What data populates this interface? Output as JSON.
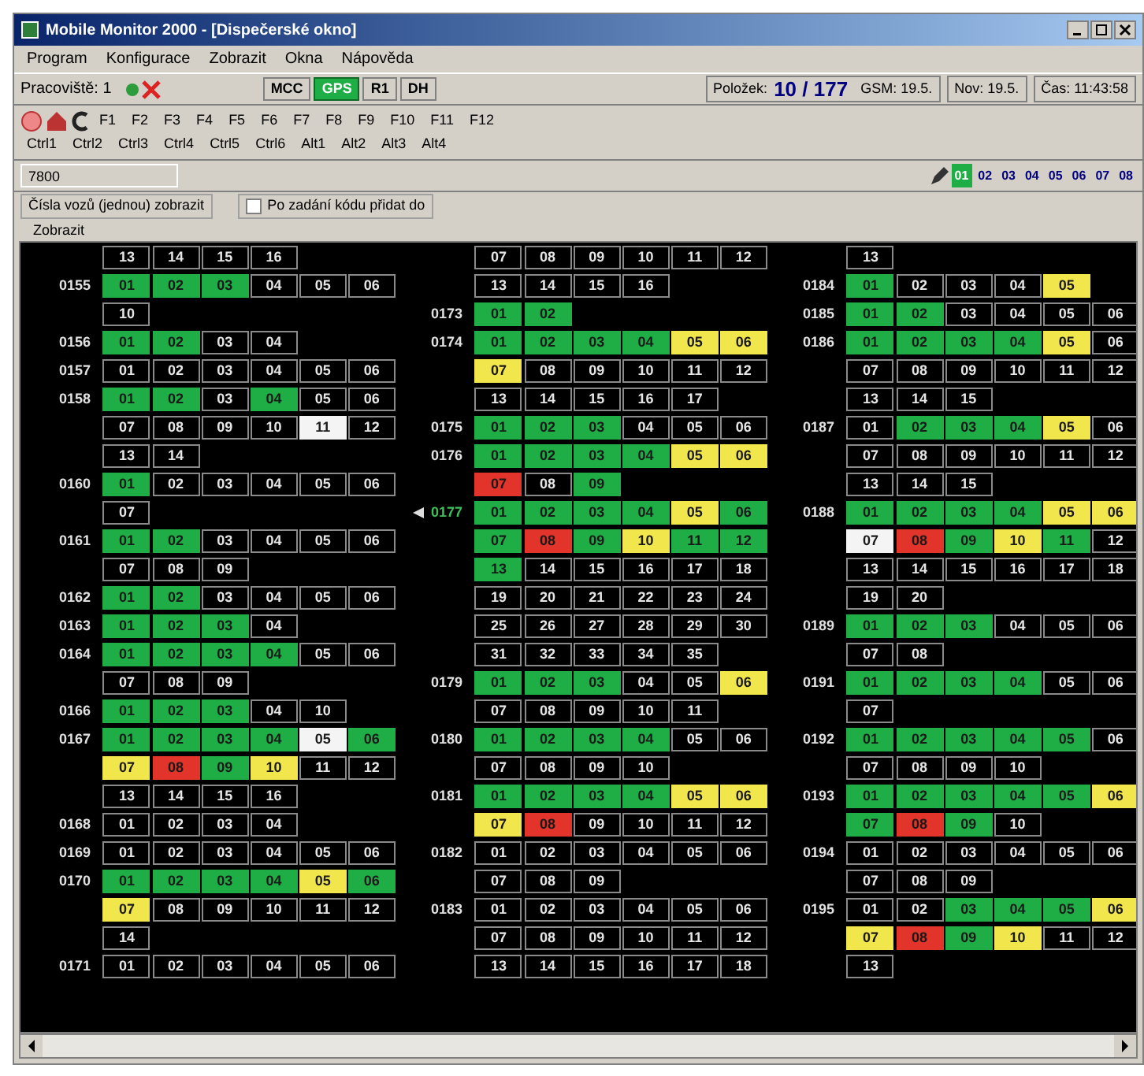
{
  "window": {
    "title": "Mobile Monitor 2000 - [Dispečerské okno]"
  },
  "menu": [
    "Program",
    "Konfigurace",
    "Zobrazit",
    "Okna",
    "Nápověda"
  ],
  "toolbar": {
    "workstation": "Pracoviště: 1",
    "modes": [
      {
        "label": "MCC",
        "selected": false
      },
      {
        "label": "GPS",
        "selected": true
      },
      {
        "label": "R1",
        "selected": false
      },
      {
        "label": "DH",
        "selected": false
      }
    ],
    "count_label": "Položek:",
    "count": "10 / 177",
    "gsm": "GSM: 19.5.",
    "nov": "Nov: 19.5.",
    "time": "Čas: 11:43:58"
  },
  "keys_row_1": [
    "F1",
    "F2",
    "F3",
    "F4",
    "F5",
    "F6",
    "F7",
    "F8",
    "F9",
    "F10",
    "F11",
    "F12"
  ],
  "keys_row_2": [
    "Ctrl1",
    "Ctrl2",
    "Ctrl3",
    "Ctrl4",
    "Ctrl5",
    "Ctrl6",
    "Alt1",
    "Alt2",
    "Alt3",
    "Alt4"
  ],
  "code_field": {
    "value": "7800"
  },
  "lines": [
    {
      "label": "01",
      "selected": true
    },
    {
      "label": "02",
      "selected": false
    },
    {
      "label": "03",
      "selected": false
    },
    {
      "label": "04",
      "selected": false
    },
    {
      "label": "05",
      "selected": false
    },
    {
      "label": "06",
      "selected": false
    },
    {
      "label": "07",
      "selected": false
    },
    {
      "label": "08",
      "selected": false
    }
  ],
  "filter": {
    "label": "Čísla vozů (jednou) zobrazit",
    "checkbox": {
      "label": "Po zadání kódu přidat do",
      "checked": false
    },
    "sub_label": "Zobrazit"
  },
  "columns": [
    {
      "groups": [
        {
          "cells": [
            {
              "text": "13"
            },
            {
              "text": "14"
            },
            {
              "text": "15"
            },
            {
              "text": "16"
            }
          ]
        },
        {
          "label": "0155",
          "current": false,
          "cells": [
            {
              "text": "01",
              "color": "#1fae45"
            },
            {
              "text": "02",
              "color": "#1fae45"
            },
            {
              "text": "03",
              "color": "#1fae45"
            },
            {
              "text": "04"
            },
            {
              "text": "05"
            },
            {
              "text": "06"
            },
            {
              "text": "10"
            }
          ]
        },
        {
          "label": "0156",
          "current": false,
          "cells": [
            {
              "text": "01",
              "color": "#1fae45"
            },
            {
              "text": "02",
              "color": "#1fae45"
            },
            {
              "text": "03"
            },
            {
              "text": "04"
            }
          ]
        },
        {
          "label": "0157",
          "current": false,
          "cells": [
            {
              "text": "01"
            },
            {
              "text": "02"
            },
            {
              "text": "03"
            },
            {
              "text": "04"
            },
            {
              "text": "05"
            },
            {
              "text": "06"
            }
          ]
        },
        {
          "label": "0158",
          "current": false,
          "cells": [
            {
              "text": "01",
              "color": "#1fae45"
            },
            {
              "text": "02",
              "color": "#1fae45"
            },
            {
              "text": "03"
            },
            {
              "text": "04",
              "color": "#1fae45"
            },
            {
              "text": "05"
            },
            {
              "text": "06"
            },
            {
              "text": "07"
            },
            {
              "text": "08"
            },
            {
              "text": "09"
            },
            {
              "text": "10"
            },
            {
              "text": "11",
              "color": "#f4f4f4"
            },
            {
              "text": "12"
            },
            {
              "text": "13"
            },
            {
              "text": "14"
            }
          ]
        },
        {
          "label": "0160",
          "current": false,
          "cells": [
            {
              "text": "01",
              "color": "#1fae45"
            },
            {
              "text": "02"
            },
            {
              "text": "03"
            },
            {
              "text": "04"
            },
            {
              "text": "05"
            },
            {
              "text": "06"
            },
            {
              "text": "07"
            }
          ]
        },
        {
          "label": "0161",
          "current": false,
          "cells": [
            {
              "text": "01",
              "color": "#1fae45"
            },
            {
              "text": "02",
              "color": "#1fae45"
            },
            {
              "text": "03"
            },
            {
              "text": "04"
            },
            {
              "text": "05"
            },
            {
              "text": "06"
            },
            {
              "text": "07"
            },
            {
              "text": "08"
            },
            {
              "text": "09"
            }
          ]
        },
        {
          "label": "0162",
          "current": false,
          "cells": [
            {
              "text": "01",
              "color": "#1fae45"
            },
            {
              "text": "02",
              "color": "#1fae45"
            },
            {
              "text": "03"
            },
            {
              "text": "04"
            },
            {
              "text": "05"
            },
            {
              "text": "06"
            }
          ]
        },
        {
          "label": "0163",
          "current": false,
          "cells": [
            {
              "text": "01",
              "color": "#1fae45"
            },
            {
              "text": "02",
              "color": "#1fae45"
            },
            {
              "text": "03",
              "color": "#1fae45"
            },
            {
              "text": "04"
            }
          ]
        },
        {
          "label": "0164",
          "current": false,
          "cells": [
            {
              "text": "01",
              "color": "#1fae45"
            },
            {
              "text": "02",
              "color": "#1fae45"
            },
            {
              "text": "03",
              "color": "#1fae45"
            },
            {
              "text": "04",
              "color": "#1fae45"
            },
            {
              "text": "05"
            },
            {
              "text": "06"
            },
            {
              "text": "07"
            },
            {
              "text": "08"
            },
            {
              "text": "09"
            }
          ]
        },
        {
          "label": "0166",
          "current": false,
          "cells": [
            {
              "text": "01",
              "color": "#1fae45"
            },
            {
              "text": "02",
              "color": "#1fae45"
            },
            {
              "text": "03",
              "color": "#1fae45"
            },
            {
              "text": "04"
            },
            {
              "text": "10"
            }
          ]
        },
        {
          "label": "0167",
          "current": false,
          "cells": [
            {
              "text": "01",
              "color": "#1fae45"
            },
            {
              "text": "02",
              "color": "#1fae45"
            },
            {
              "text": "03",
              "color": "#1fae45"
            },
            {
              "text": "04",
              "color": "#1fae45"
            },
            {
              "text": "05",
              "color": "#f4f4f4"
            },
            {
              "text": "06",
              "color": "#1fae45"
            },
            {
              "text": "07",
              "color": "#f1e64c"
            },
            {
              "text": "08",
              "color": "#e2342b"
            },
            {
              "text": "09",
              "color": "#1fae45"
            },
            {
              "text": "10",
              "color": "#f1e64c"
            },
            {
              "text": "11"
            },
            {
              "text": "12"
            },
            {
              "text": "13"
            },
            {
              "text": "14"
            },
            {
              "text": "15"
            },
            {
              "text": "16"
            }
          ]
        },
        {
          "label": "0168",
          "current": false,
          "cells": [
            {
              "text": "01"
            },
            {
              "text": "02"
            },
            {
              "text": "03"
            },
            {
              "text": "04"
            }
          ]
        },
        {
          "label": "0169",
          "current": false,
          "cells": [
            {
              "text": "01"
            },
            {
              "text": "02"
            },
            {
              "text": "03"
            },
            {
              "text": "04"
            },
            {
              "text": "05"
            },
            {
              "text": "06"
            }
          ]
        },
        {
          "label": "0170",
          "current": false,
          "cells": [
            {
              "text": "01",
              "color": "#1fae45"
            },
            {
              "text": "02",
              "color": "#1fae45"
            },
            {
              "text": "03",
              "color": "#1fae45"
            },
            {
              "text": "04",
              "color": "#1fae45"
            },
            {
              "text": "05",
              "color": "#f1e64c"
            },
            {
              "text": "06",
              "color": "#1fae45"
            },
            {
              "text": "07",
              "color": "#f1e64c"
            },
            {
              "text": "08"
            },
            {
              "text": "09"
            },
            {
              "text": "10"
            },
            {
              "text": "11"
            },
            {
              "text": "12"
            },
            {
              "text": "14"
            }
          ]
        },
        {
          "label": "0171",
          "current": false,
          "cells": [
            {
              "text": "01"
            },
            {
              "text": "02"
            },
            {
              "text": "03"
            },
            {
              "text": "04"
            },
            {
              "text": "05"
            },
            {
              "text": "06"
            }
          ]
        }
      ]
    },
    {
      "groups": [
        {
          "cells": [
            {
              "text": "07"
            },
            {
              "text": "08"
            },
            {
              "text": "09"
            },
            {
              "text": "10"
            },
            {
              "text": "11"
            },
            {
              "text": "12"
            },
            {
              "text": "13"
            },
            {
              "text": "14"
            },
            {
              "text": "15"
            },
            {
              "text": "16"
            }
          ]
        },
        {
          "label": "0173",
          "current": false,
          "cells": [
            {
              "text": "01",
              "color": "#1fae45"
            },
            {
              "text": "02",
              "color": "#1fae45"
            }
          ]
        },
        {
          "label": "0174",
          "current": false,
          "cells": [
            {
              "text": "01",
              "color": "#1fae45"
            },
            {
              "text": "02",
              "color": "#1fae45"
            },
            {
              "text": "03",
              "color": "#1fae45"
            },
            {
              "text": "04",
              "color": "#1fae45"
            },
            {
              "text": "05",
              "color": "#f1e64c"
            },
            {
              "text": "06",
              "color": "#f1e64c"
            },
            {
              "text": "07",
              "color": "#f1e64c"
            },
            {
              "text": "08"
            },
            {
              "text": "09"
            },
            {
              "text": "10"
            },
            {
              "text": "11"
            },
            {
              "text": "12"
            },
            {
              "text": "13"
            },
            {
              "text": "14"
            },
            {
              "text": "15"
            },
            {
              "text": "16"
            },
            {
              "text": "17"
            }
          ]
        },
        {
          "label": "0175",
          "current": false,
          "cells": [
            {
              "text": "01",
              "color": "#1fae45"
            },
            {
              "text": "02",
              "color": "#1fae45"
            },
            {
              "text": "03",
              "color": "#1fae45"
            },
            {
              "text": "04"
            },
            {
              "text": "05"
            },
            {
              "text": "06"
            }
          ]
        },
        {
          "label": "0176",
          "current": false,
          "cells": [
            {
              "text": "01",
              "color": "#1fae45"
            },
            {
              "text": "02",
              "color": "#1fae45"
            },
            {
              "text": "03",
              "color": "#1fae45"
            },
            {
              "text": "04",
              "color": "#1fae45"
            },
            {
              "text": "05",
              "color": "#f1e64c"
            },
            {
              "text": "06",
              "color": "#f1e64c"
            },
            {
              "text": "07",
              "color": "#e2342b"
            },
            {
              "text": "08"
            },
            {
              "text": "09",
              "color": "#1fae45"
            }
          ]
        },
        {
          "label": "0177",
          "current": true,
          "cells": [
            {
              "text": "01",
              "color": "#1fae45"
            },
            {
              "text": "02",
              "color": "#1fae45"
            },
            {
              "text": "03",
              "color": "#1fae45"
            },
            {
              "text": "04",
              "color": "#1fae45"
            },
            {
              "text": "05",
              "color": "#f1e64c"
            },
            {
              "text": "06",
              "color": "#1fae45"
            },
            {
              "text": "07",
              "color": "#1fae45"
            },
            {
              "text": "08",
              "color": "#e2342b"
            },
            {
              "text": "09",
              "color": "#1fae45"
            },
            {
              "text": "10",
              "color": "#f1e64c"
            },
            {
              "text": "11",
              "color": "#1fae45"
            },
            {
              "text": "12",
              "color": "#1fae45"
            },
            {
              "text": "13",
              "color": "#1fae45"
            },
            {
              "text": "14"
            },
            {
              "text": "15"
            },
            {
              "text": "16"
            },
            {
              "text": "17"
            },
            {
              "text": "18"
            },
            {
              "text": "19"
            },
            {
              "text": "20"
            },
            {
              "text": "21"
            },
            {
              "text": "22"
            },
            {
              "text": "23"
            },
            {
              "text": "24"
            },
            {
              "text": "25"
            },
            {
              "text": "26"
            },
            {
              "text": "27"
            },
            {
              "text": "28"
            },
            {
              "text": "29"
            },
            {
              "text": "30"
            },
            {
              "text": "31"
            },
            {
              "text": "32"
            },
            {
              "text": "33"
            },
            {
              "text": "34"
            },
            {
              "text": "35"
            }
          ]
        },
        {
          "label": "0179",
          "current": false,
          "cells": [
            {
              "text": "01",
              "color": "#1fae45"
            },
            {
              "text": "02",
              "color": "#1fae45"
            },
            {
              "text": "03",
              "color": "#1fae45"
            },
            {
              "text": "04"
            },
            {
              "text": "05"
            },
            {
              "text": "06",
              "color": "#f1e64c"
            },
            {
              "text": "07"
            },
            {
              "text": "08"
            },
            {
              "text": "09"
            },
            {
              "text": "10"
            },
            {
              "text": "11"
            }
          ]
        },
        {
          "label": "0180",
          "current": false,
          "cells": [
            {
              "text": "01",
              "color": "#1fae45"
            },
            {
              "text": "02",
              "color": "#1fae45"
            },
            {
              "text": "03",
              "color": "#1fae45"
            },
            {
              "text": "04",
              "color": "#1fae45"
            },
            {
              "text": "05"
            },
            {
              "text": "06"
            },
            {
              "text": "07"
            },
            {
              "text": "08"
            },
            {
              "text": "09"
            },
            {
              "text": "10"
            }
          ]
        },
        {
          "label": "0181",
          "current": false,
          "cells": [
            {
              "text": "01",
              "color": "#1fae45"
            },
            {
              "text": "02",
              "color": "#1fae45"
            },
            {
              "text": "03",
              "color": "#1fae45"
            },
            {
              "text": "04",
              "color": "#1fae45"
            },
            {
              "text": "05",
              "color": "#f1e64c"
            },
            {
              "text": "06",
              "color": "#f1e64c"
            },
            {
              "text": "07",
              "color": "#f1e64c"
            },
            {
              "text": "08",
              "color": "#e2342b"
            },
            {
              "text": "09"
            },
            {
              "text": "10"
            },
            {
              "text": "11"
            },
            {
              "text": "12"
            }
          ]
        },
        {
          "label": "0182",
          "current": false,
          "cells": [
            {
              "text": "01"
            },
            {
              "text": "02"
            },
            {
              "text": "03"
            },
            {
              "text": "04"
            },
            {
              "text": "05"
            },
            {
              "text": "06"
            },
            {
              "text": "07"
            },
            {
              "text": "08"
            },
            {
              "text": "09"
            }
          ]
        },
        {
          "label": "0183",
          "current": false,
          "cells": [
            {
              "text": "01"
            },
            {
              "text": "02"
            },
            {
              "text": "03"
            },
            {
              "text": "04"
            },
            {
              "text": "05"
            },
            {
              "text": "06"
            },
            {
              "text": "07"
            },
            {
              "text": "08"
            },
            {
              "text": "09"
            },
            {
              "text": "10"
            },
            {
              "text": "11"
            },
            {
              "text": "12"
            },
            {
              "text": "13"
            },
            {
              "text": "14"
            },
            {
              "text": "15"
            },
            {
              "text": "16"
            },
            {
              "text": "17"
            },
            {
              "text": "18"
            }
          ]
        }
      ]
    },
    {
      "groups": [
        {
          "cells": [
            {
              "text": "13"
            }
          ]
        },
        {
          "label": "0184",
          "current": false,
          "cells": [
            {
              "text": "01",
              "color": "#1fae45"
            },
            {
              "text": "02"
            },
            {
              "text": "03"
            },
            {
              "text": "04"
            },
            {
              "text": "05",
              "color": "#f1e64c"
            }
          ]
        },
        {
          "label": "0185",
          "current": false,
          "cells": [
            {
              "text": "01",
              "color": "#1fae45"
            },
            {
              "text": "02",
              "color": "#1fae45"
            },
            {
              "text": "03"
            },
            {
              "text": "04"
            },
            {
              "text": "05"
            },
            {
              "text": "06"
            }
          ]
        },
        {
          "label": "0186",
          "current": false,
          "cells": [
            {
              "text": "01",
              "color": "#1fae45"
            },
            {
              "text": "02",
              "color": "#1fae45"
            },
            {
              "text": "03",
              "color": "#1fae45"
            },
            {
              "text": "04",
              "color": "#1fae45"
            },
            {
              "text": "05",
              "color": "#f1e64c"
            },
            {
              "text": "06"
            },
            {
              "text": "07"
            },
            {
              "text": "08"
            },
            {
              "text": "09"
            },
            {
              "text": "10"
            },
            {
              "text": "11"
            },
            {
              "text": "12"
            },
            {
              "text": "13"
            },
            {
              "text": "14"
            },
            {
              "text": "15"
            }
          ]
        },
        {
          "label": "0187",
          "current": false,
          "cells": [
            {
              "text": "01"
            },
            {
              "text": "02",
              "color": "#1fae45"
            },
            {
              "text": "03",
              "color": "#1fae45"
            },
            {
              "text": "04",
              "color": "#1fae45"
            },
            {
              "text": "05",
              "color": "#f1e64c"
            },
            {
              "text": "06"
            },
            {
              "text": "07"
            },
            {
              "text": "08"
            },
            {
              "text": "09"
            },
            {
              "text": "10"
            },
            {
              "text": "11"
            },
            {
              "text": "12"
            },
            {
              "text": "13"
            },
            {
              "text": "14"
            },
            {
              "text": "15"
            }
          ]
        },
        {
          "label": "0188",
          "current": false,
          "cells": [
            {
              "text": "01",
              "color": "#1fae45"
            },
            {
              "text": "02",
              "color": "#1fae45"
            },
            {
              "text": "03",
              "color": "#1fae45"
            },
            {
              "text": "04",
              "color": "#1fae45"
            },
            {
              "text": "05",
              "color": "#f1e64c"
            },
            {
              "text": "06",
              "color": "#f1e64c"
            },
            {
              "text": "07",
              "color": "#f4f4f4"
            },
            {
              "text": "08",
              "color": "#e2342b"
            },
            {
              "text": "09",
              "color": "#1fae45"
            },
            {
              "text": "10",
              "color": "#f1e64c"
            },
            {
              "text": "11",
              "color": "#1fae45"
            },
            {
              "text": "12"
            },
            {
              "text": "13"
            },
            {
              "text": "14"
            },
            {
              "text": "15"
            },
            {
              "text": "16"
            },
            {
              "text": "17"
            },
            {
              "text": "18"
            },
            {
              "text": "19"
            },
            {
              "text": "20"
            }
          ]
        },
        {
          "label": "0189",
          "current": false,
          "cells": [
            {
              "text": "01",
              "color": "#1fae45"
            },
            {
              "text": "02",
              "color": "#1fae45"
            },
            {
              "text": "03",
              "color": "#1fae45"
            },
            {
              "text": "04"
            },
            {
              "text": "05"
            },
            {
              "text": "06"
            },
            {
              "text": "07"
            },
            {
              "text": "08"
            }
          ]
        },
        {
          "label": "0191",
          "current": false,
          "cells": [
            {
              "text": "01",
              "color": "#1fae45"
            },
            {
              "text": "02",
              "color": "#1fae45"
            },
            {
              "text": "03",
              "color": "#1fae45"
            },
            {
              "text": "04",
              "color": "#1fae45"
            },
            {
              "text": "05"
            },
            {
              "text": "06"
            },
            {
              "text": "07"
            }
          ]
        },
        {
          "label": "0192",
          "current": false,
          "cells": [
            {
              "text": "01",
              "color": "#1fae45"
            },
            {
              "text": "02",
              "color": "#1fae45"
            },
            {
              "text": "03",
              "color": "#1fae45"
            },
            {
              "text": "04",
              "color": "#1fae45"
            },
            {
              "text": "05",
              "color": "#1fae45"
            },
            {
              "text": "06"
            },
            {
              "text": "07"
            },
            {
              "text": "08"
            },
            {
              "text": "09"
            },
            {
              "text": "10"
            }
          ]
        },
        {
          "label": "0193",
          "current": false,
          "cells": [
            {
              "text": "01",
              "color": "#1fae45"
            },
            {
              "text": "02",
              "color": "#1fae45"
            },
            {
              "text": "03",
              "color": "#1fae45"
            },
            {
              "text": "04",
              "color": "#1fae45"
            },
            {
              "text": "05",
              "color": "#1fae45"
            },
            {
              "text": "06",
              "color": "#f1e64c"
            },
            {
              "text": "07",
              "color": "#1fae45"
            },
            {
              "text": "08",
              "color": "#e2342b"
            },
            {
              "text": "09",
              "color": "#1fae45"
            },
            {
              "text": "10"
            }
          ]
        },
        {
          "label": "0194",
          "current": false,
          "cells": [
            {
              "text": "01"
            },
            {
              "text": "02"
            },
            {
              "text": "03"
            },
            {
              "text": "04"
            },
            {
              "text": "05"
            },
            {
              "text": "06"
            },
            {
              "text": "07"
            },
            {
              "text": "08"
            },
            {
              "text": "09"
            }
          ]
        },
        {
          "label": "0195",
          "current": false,
          "cells": [
            {
              "text": "01"
            },
            {
              "text": "02"
            },
            {
              "text": "03",
              "color": "#1fae45"
            },
            {
              "text": "04",
              "color": "#1fae45"
            },
            {
              "text": "05",
              "color": "#1fae45"
            },
            {
              "text": "06",
              "color": "#f1e64c"
            },
            {
              "text": "07",
              "color": "#f1e64c"
            },
            {
              "text": "08",
              "color": "#e2342b"
            },
            {
              "text": "09",
              "color": "#1fae45"
            },
            {
              "text": "10",
              "color": "#f1e64c"
            },
            {
              "text": "11"
            },
            {
              "text": "12"
            },
            {
              "text": "13"
            }
          ]
        }
      ]
    }
  ]
}
